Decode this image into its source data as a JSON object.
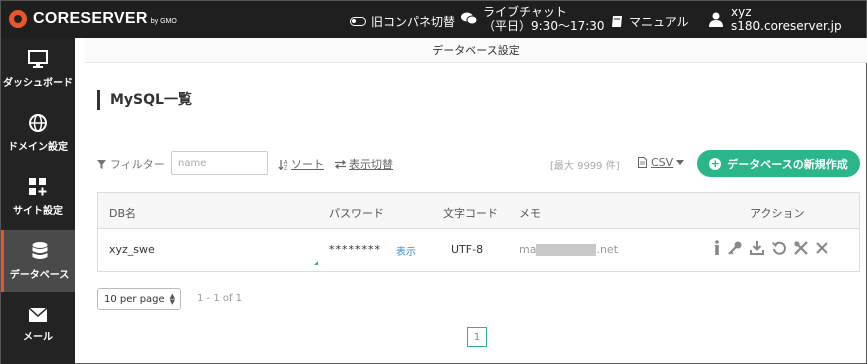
{
  "header": {
    "logo_text": "CORESERVER",
    "logo_sub": "by GMO",
    "old_panel_label": "旧コンパネ切替",
    "live_chat_title": "ライブチャット",
    "live_chat_hours": "（平日）9:30～17:30",
    "manual_label": "マニュアル",
    "user_name": "xyz",
    "user_server": "s180.coreserver.jp"
  },
  "sidebar": {
    "items": [
      {
        "label": "ダッシュボード",
        "icon": "monitor-icon",
        "active": false
      },
      {
        "label": "ドメイン設定",
        "icon": "globe-icon",
        "active": false
      },
      {
        "label": "サイト設定",
        "icon": "grid-plus-icon",
        "active": false
      },
      {
        "label": "データベース",
        "icon": "database-icon",
        "active": true
      },
      {
        "label": "メール",
        "icon": "mail-icon",
        "active": false
      }
    ]
  },
  "main": {
    "subheader": "データベース設定",
    "title": "MySQL一覧",
    "toolbar": {
      "filter_label": "フィルター",
      "filter_placeholder": "name",
      "sort_label": "ソート",
      "display_toggle_label": "表示切替",
      "max_text": "[最大 9999 件]",
      "csv_label": "CSV",
      "new_button_label": "データベースの新規作成"
    },
    "table": {
      "headers": [
        "DB名",
        "パスワード",
        "文字コード",
        "メモ",
        "アクション"
      ],
      "rows": [
        {
          "db_name": "xyz_swe",
          "password": "********",
          "show_label": "表示",
          "charset": "UTF-8",
          "memo_prefix": "ma",
          "memo_suffix": ".net"
        }
      ],
      "action_icons": [
        "info-icon",
        "key-icon",
        "download-icon",
        "restore-icon",
        "tools-icon",
        "delete-icon"
      ]
    },
    "pagination": {
      "per_page": "10 per page",
      "range": "1 - 1 of 1",
      "current_page": "1"
    }
  },
  "colors": {
    "accent": "#2ab68a",
    "brand": "#e8562a",
    "topbar": "#1f1f1f",
    "sidebar": "#232323"
  }
}
